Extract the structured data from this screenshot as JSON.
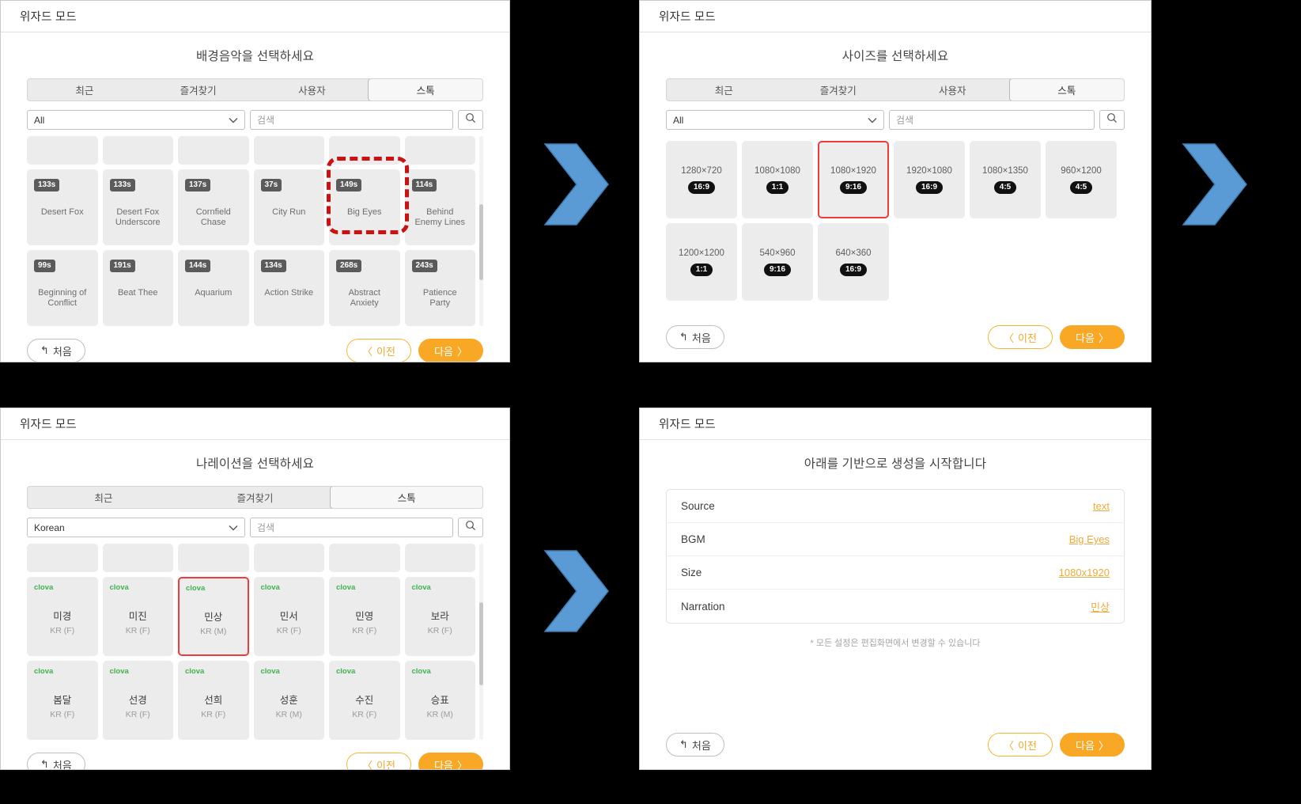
{
  "window_title": "위자드 모드",
  "common": {
    "search_placeholder": "검색",
    "search_icon": "search-icon",
    "caret_icon": "chevron-down-icon",
    "home_label": "처음",
    "prev_label": "이전",
    "next_label": "다음",
    "home_icon": "undo-arrow-icon",
    "prev_icon": "chevron-left-icon",
    "next_icon": "chevron-right-icon",
    "accent_orange": "#f9a825",
    "select_red": "#ef3b3b",
    "highlight_red": "#cc1111",
    "arrow_blue": "#5b9bd5",
    "clova_green": "#3fb34f"
  },
  "panel_bgm": {
    "title": "배경음악을 선택하세요",
    "tabs": [
      {
        "label": "최근",
        "active": false
      },
      {
        "label": "즐겨찾기",
        "active": false
      },
      {
        "label": "사용자",
        "active": false
      },
      {
        "label": "스톡",
        "active": true
      }
    ],
    "filter_value": "All",
    "cards": [
      {
        "duration": "133s",
        "title": "Desert Fox"
      },
      {
        "duration": "133s",
        "title": "Desert Fox Underscore"
      },
      {
        "duration": "137s",
        "title": "Cornfield Chase"
      },
      {
        "duration": "37s",
        "title": "City Run"
      },
      {
        "duration": "149s",
        "title": "Big Eyes",
        "highlighted": true
      },
      {
        "duration": "114s",
        "title": "Behind Enemy Lines"
      },
      {
        "duration": "99s",
        "title": "Beginning of Conflict"
      },
      {
        "duration": "191s",
        "title": "Beat Thee"
      },
      {
        "duration": "144s",
        "title": "Aquarium"
      },
      {
        "duration": "134s",
        "title": "Action Strike"
      },
      {
        "duration": "268s",
        "title": "Abstract Anxiety"
      },
      {
        "duration": "243s",
        "title": "Patience Party"
      }
    ]
  },
  "panel_size": {
    "title": "사이즈를 선택하세요",
    "tabs": [
      {
        "label": "최근",
        "active": false
      },
      {
        "label": "즐겨찾기",
        "active": false
      },
      {
        "label": "사용자",
        "active": false
      },
      {
        "label": "스톡",
        "active": true
      }
    ],
    "filter_value": "All",
    "cards": [
      {
        "size": "1280×720",
        "ratio": "16:9"
      },
      {
        "size": "1080×1080",
        "ratio": "1:1"
      },
      {
        "size": "1080×1920",
        "ratio": "9:16",
        "selected": true
      },
      {
        "size": "1920×1080",
        "ratio": "16:9"
      },
      {
        "size": "1080×1350",
        "ratio": "4:5"
      },
      {
        "size": "960×1200",
        "ratio": "4:5"
      },
      {
        "size": "1200×1200",
        "ratio": "1:1"
      },
      {
        "size": "540×960",
        "ratio": "9:16"
      },
      {
        "size": "640×360",
        "ratio": "16:9"
      }
    ]
  },
  "panel_narration": {
    "title": "나레이션을 선택하세요",
    "tabs": [
      {
        "label": "최근",
        "active": false
      },
      {
        "label": "즐겨찾기",
        "active": false
      },
      {
        "label": "스톡",
        "active": true
      }
    ],
    "filter_value": "Korean",
    "cards": [
      {
        "vendor": "clova",
        "name": "미경",
        "meta": "KR (F)"
      },
      {
        "vendor": "clova",
        "name": "미진",
        "meta": "KR (F)"
      },
      {
        "vendor": "clova",
        "name": "민상",
        "meta": "KR (M)",
        "selected": true
      },
      {
        "vendor": "clova",
        "name": "민서",
        "meta": "KR (F)"
      },
      {
        "vendor": "clova",
        "name": "민영",
        "meta": "KR (F)"
      },
      {
        "vendor": "clova",
        "name": "보라",
        "meta": "KR (F)"
      },
      {
        "vendor": "clova",
        "name": "봄달",
        "meta": "KR (F)"
      },
      {
        "vendor": "clova",
        "name": "선경",
        "meta": "KR (F)"
      },
      {
        "vendor": "clova",
        "name": "선희",
        "meta": "KR (F)"
      },
      {
        "vendor": "clova",
        "name": "성훈",
        "meta": "KR (M)"
      },
      {
        "vendor": "clova",
        "name": "수진",
        "meta": "KR (F)"
      },
      {
        "vendor": "clova",
        "name": "승표",
        "meta": "KR (M)"
      }
    ]
  },
  "panel_summary": {
    "title": "아래를 기반으로 생성을 시작합니다",
    "rows": [
      {
        "key": "Source",
        "value": "text"
      },
      {
        "key": "BGM",
        "value": "Big Eyes"
      },
      {
        "key": "Size",
        "value": "1080x1920"
      },
      {
        "key": "Narration",
        "value": "민상"
      }
    ],
    "note": "* 모든 설정은 편집화면에서 변경할 수 있습니다"
  }
}
